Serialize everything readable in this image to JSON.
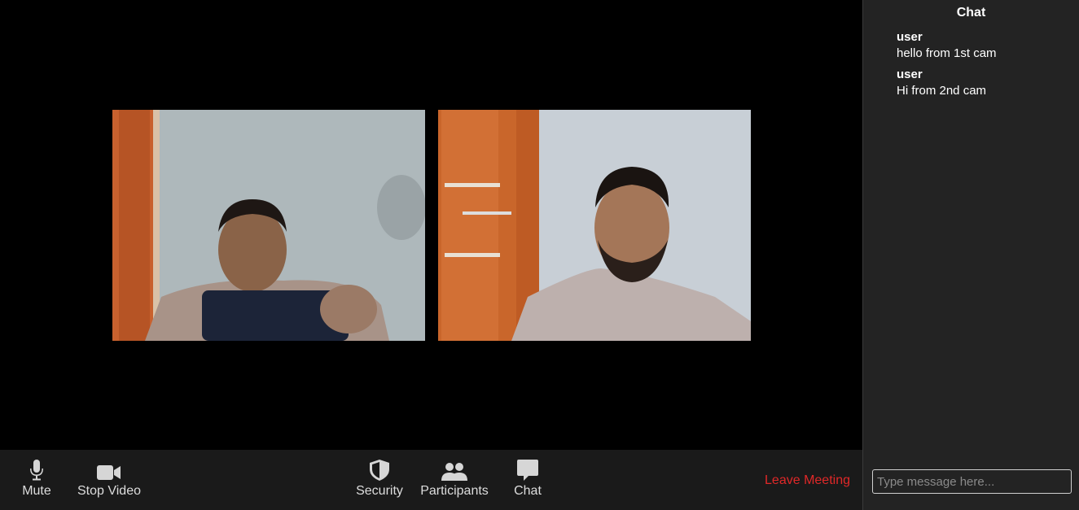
{
  "toolbar": {
    "mute_label": "Mute",
    "stop_video_label": "Stop Video",
    "security_label": "Security",
    "participants_label": "Participants",
    "chat_label": "Chat",
    "leave_label": "Leave Meeting"
  },
  "chat": {
    "title": "Chat",
    "messages": [
      {
        "user": "user",
        "text": "hello from 1st cam"
      },
      {
        "user": "user",
        "text": "Hi from 2nd cam"
      }
    ],
    "input_placeholder": "Type message here..."
  },
  "colors": {
    "leave": "#e02828",
    "toolbar_bg": "#1a1a1a",
    "chat_bg": "#232323"
  },
  "icons": [
    "microphone-icon",
    "video-camera-icon",
    "shield-icon",
    "participants-icon",
    "chat-bubble-icon"
  ]
}
